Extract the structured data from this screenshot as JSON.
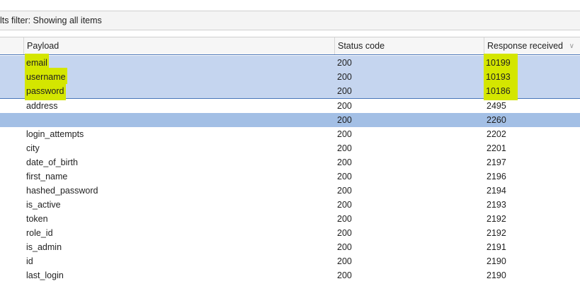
{
  "filter": {
    "text": "lts filter: Showing all items"
  },
  "columns": {
    "payload": "Payload",
    "status": "Status code",
    "response": "Response received"
  },
  "rows": [
    {
      "payload": "email",
      "status": "200",
      "response": "10199",
      "state": "selected",
      "highlight": true
    },
    {
      "payload": "username",
      "status": "200",
      "response": "10193",
      "state": "selected",
      "highlight": true
    },
    {
      "payload": "password",
      "status": "200",
      "response": "10186",
      "state": "selected",
      "highlight": true
    },
    {
      "payload": "address",
      "status": "200",
      "response": "2495",
      "state": "normal"
    },
    {
      "payload": "",
      "status": "200",
      "response": "2260",
      "state": "focused"
    },
    {
      "payload": "login_attempts",
      "status": "200",
      "response": "2202",
      "state": "normal"
    },
    {
      "payload": "city",
      "status": "200",
      "response": "2201",
      "state": "normal"
    },
    {
      "payload": "date_of_birth",
      "status": "200",
      "response": "2197",
      "state": "normal"
    },
    {
      "payload": "first_name",
      "status": "200",
      "response": "2196",
      "state": "normal"
    },
    {
      "payload": "hashed_password",
      "status": "200",
      "response": "2194",
      "state": "normal"
    },
    {
      "payload": "is_active",
      "status": "200",
      "response": "2193",
      "state": "normal"
    },
    {
      "payload": "token",
      "status": "200",
      "response": "2192",
      "state": "normal"
    },
    {
      "payload": "role_id",
      "status": "200",
      "response": "2192",
      "state": "normal"
    },
    {
      "payload": "is_admin",
      "status": "200",
      "response": "2191",
      "state": "normal"
    },
    {
      "payload": "id",
      "status": "200",
      "response": "2190",
      "state": "normal"
    },
    {
      "payload": "last_login",
      "status": "200",
      "response": "2190",
      "state": "normal"
    }
  ],
  "colors": {
    "selected": "#c5d5ef",
    "focused": "#a3bfe5",
    "highlight": "#d4e600"
  },
  "icons": {
    "sort": "chevron-down-icon"
  }
}
